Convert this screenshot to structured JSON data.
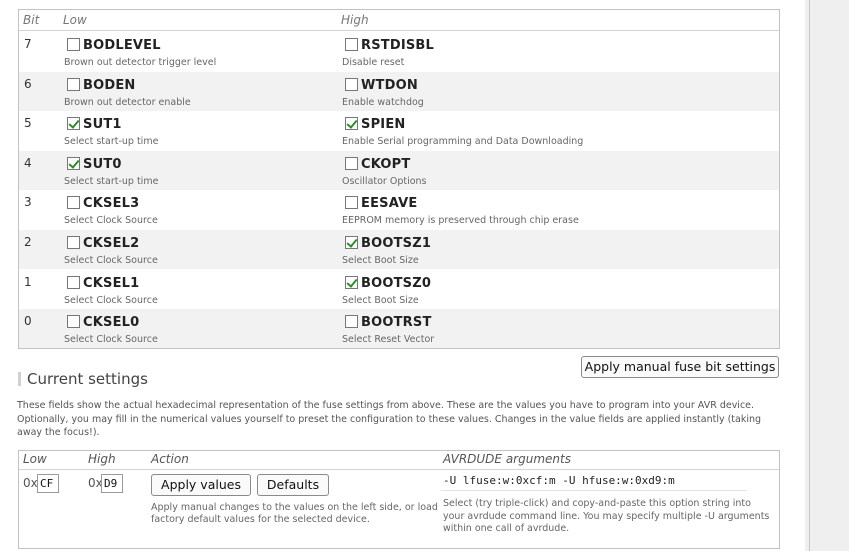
{
  "fuse_table": {
    "headers": {
      "bit": "Bit",
      "low": "Low",
      "high": "High"
    },
    "rows": [
      {
        "bit": "7",
        "low": {
          "name": "BODLEVEL",
          "desc": "Brown out detector trigger level",
          "checked": false
        },
        "high": {
          "name": "RSTDISBL",
          "desc": "Disable reset",
          "checked": false
        }
      },
      {
        "bit": "6",
        "low": {
          "name": "BODEN",
          "desc": "Brown out detector enable",
          "checked": false
        },
        "high": {
          "name": "WTDON",
          "desc": "Enable watchdog",
          "checked": false
        }
      },
      {
        "bit": "5",
        "low": {
          "name": "SUT1",
          "desc": "Select start-up time",
          "checked": true
        },
        "high": {
          "name": "SPIEN",
          "desc": "Enable Serial programming and Data Downloading",
          "checked": true
        }
      },
      {
        "bit": "4",
        "low": {
          "name": "SUT0",
          "desc": "Select start-up time",
          "checked": true
        },
        "high": {
          "name": "CKOPT",
          "desc": "Oscillator Options",
          "checked": false
        }
      },
      {
        "bit": "3",
        "low": {
          "name": "CKSEL3",
          "desc": "Select Clock Source",
          "checked": false
        },
        "high": {
          "name": "EESAVE",
          "desc": "EEPROM memory is preserved through chip erase",
          "checked": false
        }
      },
      {
        "bit": "2",
        "low": {
          "name": "CKSEL2",
          "desc": "Select Clock Source",
          "checked": false
        },
        "high": {
          "name": "BOOTSZ1",
          "desc": "Select Boot Size",
          "checked": true
        }
      },
      {
        "bit": "1",
        "low": {
          "name": "CKSEL1",
          "desc": "Select Clock Source",
          "checked": false
        },
        "high": {
          "name": "BOOTSZ0",
          "desc": "Select Boot Size",
          "checked": true
        }
      },
      {
        "bit": "0",
        "low": {
          "name": "CKSEL0",
          "desc": "Select Clock Source",
          "checked": false
        },
        "high": {
          "name": "BOOTRST",
          "desc": "Select Reset Vector",
          "checked": false
        }
      }
    ]
  },
  "apply_fuse_button": "Apply manual fuse bit settings",
  "current_settings": {
    "title": "Current settings",
    "intro": "These fields show the actual hexadecimal representation of the fuse settings from above. These are the values you have to program into your AVR device. Optionally, you may fill in the numerical values yourself to preset the configuration to these values. Changes in the value fields are applied instantly (taking away the focus!).",
    "headers": {
      "low": "Low",
      "high": "High",
      "action": "Action",
      "avrdude": "AVRDUDE arguments"
    },
    "hex_prefix": "0x",
    "low_value": "CF",
    "high_value": "D9",
    "apply_values_button": "Apply values",
    "defaults_button": "Defaults",
    "action_desc": "Apply manual changes to the values on the left side, or load factory default values for the selected device.",
    "avrdude_cmd": "-U lfuse:w:0xcf:m -U hfuse:w:0xd9:m",
    "avrdude_desc": "Select (try triple-click) and copy-and-paste this option string into your avrdude command line. You may specify multiple -U arguments within one call of avrdude."
  }
}
